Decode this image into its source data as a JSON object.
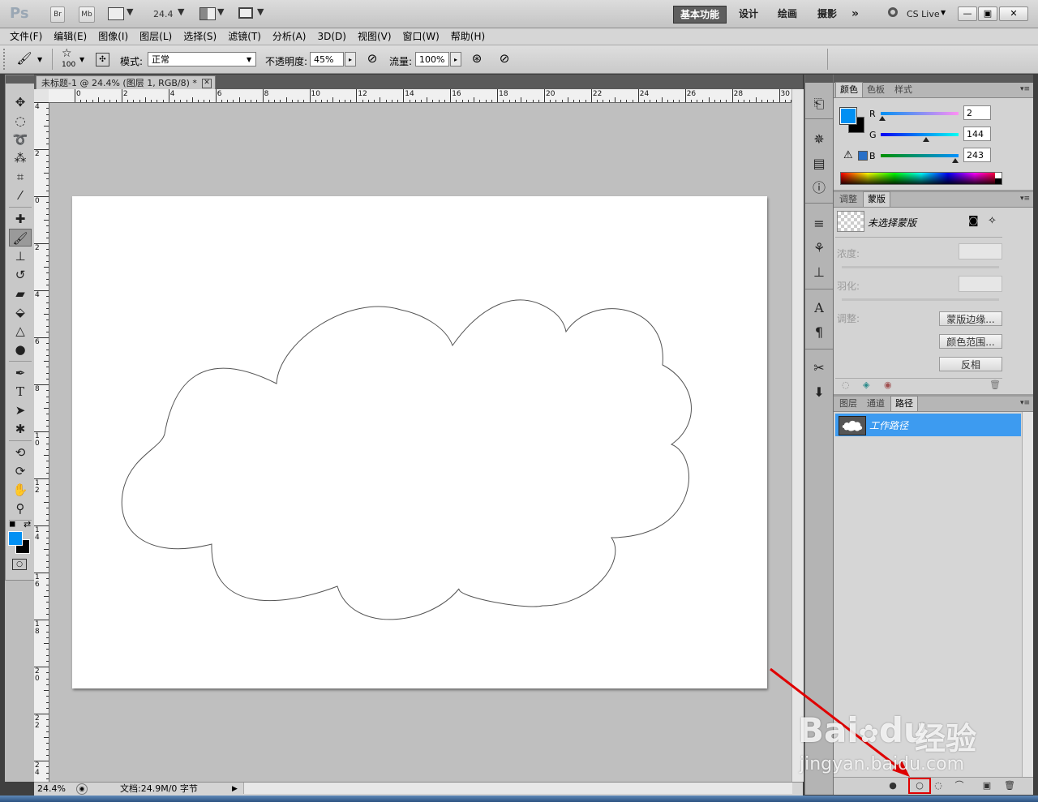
{
  "appbar": {
    "logo": "Ps",
    "br": "Br",
    "mb": "Mb",
    "zoom": "24.4",
    "workspaces": [
      "基本功能",
      "设计",
      "绘画",
      "摄影"
    ],
    "more": "»",
    "cslive": "CS Live",
    "window_buttons": [
      "—",
      "▣",
      "✕"
    ]
  },
  "menubar": {
    "items": [
      "文件(F)",
      "编辑(E)",
      "图像(I)",
      "图层(L)",
      "选择(S)",
      "滤镜(T)",
      "分析(A)",
      "3D(D)",
      "视图(V)",
      "窗口(W)",
      "帮助(H)"
    ]
  },
  "options": {
    "brush_size": "100",
    "mode_label": "模式:",
    "mode_value": "正常",
    "opacity_label": "不透明度:",
    "opacity_value": "45%",
    "flow_label": "流量:",
    "flow_value": "100%"
  },
  "toolbar": {
    "tools": [
      "move-tool",
      "marquee-tool",
      "lasso-tool",
      "quick-select-tool",
      "crop-tool",
      "eyedropper-tool",
      "healing-tool",
      "brush-tool",
      "clone-stamp-tool",
      "history-brush-tool",
      "eraser-tool",
      "paint-bucket-tool",
      "blur-tool",
      "dodge-tool",
      "pen-tool",
      "type-tool",
      "path-select-tool",
      "shape-tool",
      "3d-rotate-tool",
      "3d-orbit-tool",
      "hand-tool",
      "zoom-tool"
    ],
    "colors": {
      "foreground": "#0290F3",
      "background": "#000000"
    }
  },
  "document": {
    "tab_title": "未标题-1 @ 24.4% (图层 1, RGB/8) *",
    "tab_close": "✕",
    "ruler_h": [
      "0",
      "2",
      "4",
      "6",
      "8",
      "10",
      "12",
      "14",
      "16",
      "18",
      "20",
      "22",
      "24",
      "26",
      "28",
      "30"
    ],
    "ruler_v": [
      "4",
      "2",
      "0",
      "2",
      "4",
      "6",
      "8",
      "10",
      "12",
      "14",
      "16",
      "18",
      "20",
      "22",
      "24"
    ]
  },
  "statusbar": {
    "zoom": "24.4%",
    "doc_info": "文档:24.9M/0 字节"
  },
  "color_panel": {
    "tabs": [
      "颜色",
      "色板",
      "样式"
    ],
    "channels": [
      {
        "label": "R",
        "value": "2"
      },
      {
        "label": "G",
        "value": "144"
      },
      {
        "label": "B",
        "value": "243"
      }
    ],
    "foreground": "#0290F3",
    "background": "#000000"
  },
  "masks_panel": {
    "tabs": [
      "调整",
      "蒙版"
    ],
    "title": "未选择蒙版",
    "density_label": "浓度:",
    "feather_label": "羽化:",
    "refine_label": "调整:",
    "buttons": [
      "蒙版边缘...",
      "颜色范围...",
      "反相"
    ]
  },
  "paths_panel": {
    "tabs": [
      "图层",
      "通道",
      "路径"
    ],
    "rows": [
      {
        "name": "工作路径"
      }
    ]
  },
  "watermark": {
    "brand": "Bai",
    "brand2": "du",
    "cn": "经验",
    "url": "jingyan.baidu.com"
  }
}
